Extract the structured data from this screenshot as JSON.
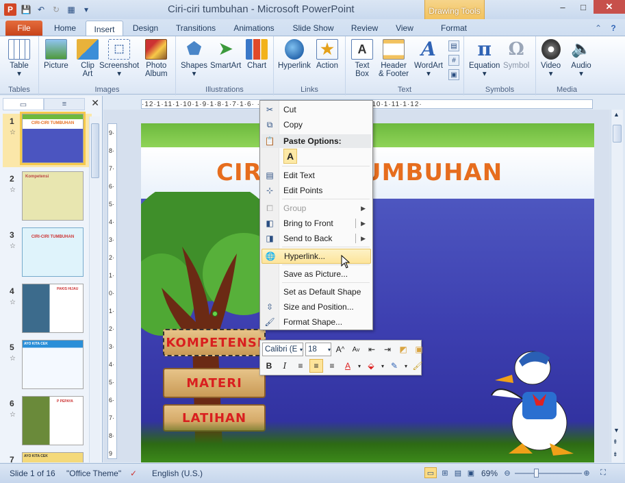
{
  "window": {
    "title": "Ciri-ciri tumbuhan - Microsoft PowerPoint",
    "contextual_tab_group": "Drawing Tools"
  },
  "tabs": [
    "File",
    "Home",
    "Insert",
    "Design",
    "Transitions",
    "Animations",
    "Slide Show",
    "Review",
    "View",
    "Format"
  ],
  "ribbon": {
    "groups": {
      "tables": "Tables",
      "images": "Images",
      "illustrations": "Illustrations",
      "links": "Links",
      "text": "Text",
      "symbols": "Symbols",
      "media": "Media"
    },
    "buttons": {
      "table": "Table",
      "picture": "Picture",
      "clip_art_1": "Clip",
      "clip_art_2": "Art",
      "screenshot": "Screenshot",
      "photo_album_1": "Photo",
      "photo_album_2": "Album",
      "shapes": "Shapes",
      "smartart": "SmartArt",
      "chart": "Chart",
      "hyperlink": "Hyperlink",
      "action": "Action",
      "text_box_1": "Text",
      "text_box_2": "Box",
      "header_footer_1": "Header",
      "header_footer_2": "& Footer",
      "wordart": "WordArt",
      "equation": "Equation",
      "symbol": "Symbol",
      "video": "Video",
      "audio": "Audio"
    }
  },
  "slides_panel": {
    "slides": [
      {
        "num": "1",
        "title": "CIRI-CIRI TUMBUHAN"
      },
      {
        "num": "2",
        "title": "Kompetensi"
      },
      {
        "num": "3",
        "title": "CIRI-CIRI TUMBUHAN"
      },
      {
        "num": "4",
        "title": "PAKIS HIJAU"
      },
      {
        "num": "5",
        "title": "AYO KITA CEK"
      },
      {
        "num": "6",
        "title": "P PEPAYA"
      },
      {
        "num": "7",
        "title": "AYO KITA CEK"
      }
    ]
  },
  "rulers": {
    "horizontal": "·12·1·11·1·10·1·9·1·8·1·7·1·6·   ·1·3·1·4·1·5·1·6·1·7·1·8·1·9·1·10·1·11·1·12·",
    "vertical": "9·8·7·6·5·4·3·2·1·0·1·2·3·4·5·6·7·8·9"
  },
  "slide": {
    "title": "CIRI-CIRI TUMBUHAN",
    "signs": [
      "KOMPETENSI",
      "MATERI",
      "LATIHAN"
    ]
  },
  "context_menu": {
    "cut": "Cut",
    "copy": "Copy",
    "paste_options": "Paste Options:",
    "paste_keep": "A",
    "edit_text": "Edit Text",
    "edit_points": "Edit Points",
    "group": "Group",
    "bring_to_front": "Bring to Front",
    "send_to_back": "Send to Back",
    "hyperlink": "Hyperlink...",
    "save_as_picture": "Save as Picture...",
    "set_default_shape": "Set as Default Shape",
    "size_and_position": "Size and Position...",
    "format_shape": "Format Shape..."
  },
  "mini_toolbar": {
    "font": "Calibri (E",
    "size": "18"
  },
  "status": {
    "slide_info": "Slide 1 of 16",
    "theme": "\"Office Theme\"",
    "language": "English (U.S.)",
    "zoom": "69%"
  },
  "colors": {
    "accent": "#d24726",
    "highlight": "#fde49a",
    "title_orange": "#e66d1e",
    "sign_text": "#d91f1f"
  }
}
